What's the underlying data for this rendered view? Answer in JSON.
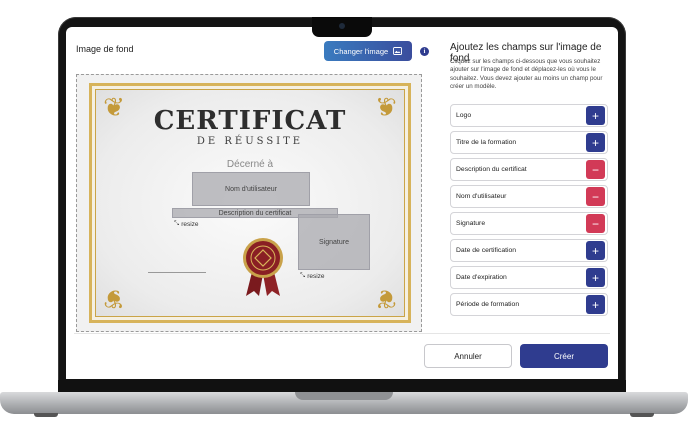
{
  "left_panel": {
    "title": "Image de fond",
    "change_button_label": "Changer l'image",
    "change_button_icon": "image-icon",
    "info_icon": "info-icon"
  },
  "certificate": {
    "title": "CERTIFICAT",
    "subtitle": "DE RÉUSSITE",
    "awarded": "Décerné à",
    "fields": {
      "username": "Nom d'utilisateur",
      "description": "Description du certificat",
      "signature": "Signature"
    },
    "resize_label": "resize"
  },
  "right_panel": {
    "title": "Ajoutez les champs sur l'image de fond",
    "description": "Cliquez sur les champs ci-dessous que vous souhaitez ajouter sur l'image de fond et déplacez-les où vous le souhaitez. Vous devez ajouter au moins un champ pour créer un modèle.",
    "fields": [
      {
        "label": "Logo",
        "action": "+"
      },
      {
        "label": "Titre de la formation",
        "action": "+"
      },
      {
        "label": "Description du certificat",
        "action": "−"
      },
      {
        "label": "Nom d'utilisateur",
        "action": "−"
      },
      {
        "label": "Signature",
        "action": "−"
      },
      {
        "label": "Date de certification",
        "action": "+"
      },
      {
        "label": "Date d'expiration",
        "action": "+"
      },
      {
        "label": "Période de formation",
        "action": "+"
      }
    ]
  },
  "footer": {
    "cancel_label": "Annuler",
    "create_label": "Créer"
  },
  "colors": {
    "primary": "#2f3c8f",
    "danger": "#d23a57",
    "gold": "#c49a3a"
  }
}
